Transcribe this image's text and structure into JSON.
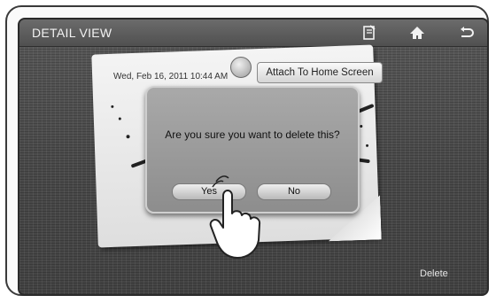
{
  "header": {
    "title": "DETAIL VIEW",
    "icons": [
      "memo-icon",
      "home-icon",
      "back-icon"
    ]
  },
  "note": {
    "date": "Wed, Feb 16, 2011 10:44 AM",
    "attach_label": "Attach To Home Screen"
  },
  "dialog": {
    "message": "Are you sure you want to delete this?",
    "yes_label": "Yes",
    "no_label": "No"
  },
  "footer": {
    "delete_label": "Delete"
  }
}
